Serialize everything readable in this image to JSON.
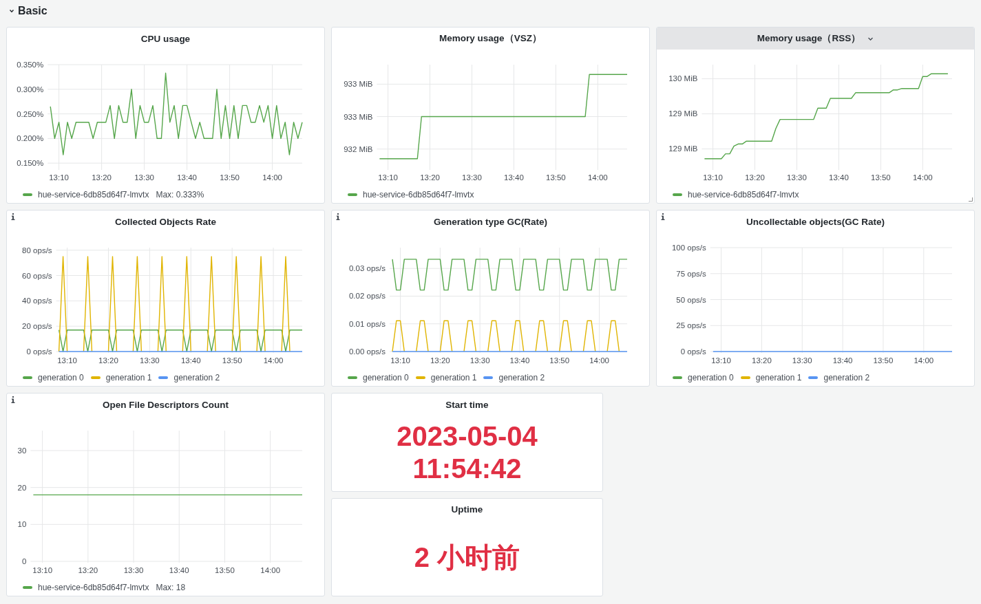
{
  "section": {
    "title": "Basic",
    "expanded": true
  },
  "panels": [
    {
      "kind": "graph",
      "title": "CPU usage",
      "hovered": false,
      "info": false,
      "legend_extra": "Max: 0.333%",
      "chart_data": {
        "type": "line",
        "grid": true,
        "ylim": [
          0.139,
          0.35
        ],
        "yticks": [
          {
            "value": 0.15,
            "label": "0.150%"
          },
          {
            "value": 0.2,
            "label": "0.200%"
          },
          {
            "value": 0.25,
            "label": "0.250%"
          },
          {
            "value": 0.3,
            "label": "0.300%"
          },
          {
            "value": 0.35,
            "label": "0.350%"
          }
        ],
        "categories": [
          null,
          null,
          "13:10",
          null,
          null,
          null,
          null,
          null,
          null,
          null,
          null,
          null,
          "13:20",
          null,
          null,
          null,
          null,
          null,
          null,
          null,
          null,
          null,
          "13:30",
          null,
          null,
          null,
          null,
          null,
          null,
          null,
          null,
          null,
          "13:40",
          null,
          null,
          null,
          null,
          null,
          null,
          null,
          null,
          null,
          "13:50",
          null,
          null,
          null,
          null,
          null,
          null,
          null,
          null,
          null,
          "14:00",
          null,
          null,
          null,
          null,
          null,
          null,
          null
        ],
        "series": [
          {
            "name": "hue-service-6db85d64f7-lmvtx",
            "color": "#56a64b",
            "values": [
              0.265,
              0.2,
              0.233,
              0.167,
              0.233,
              0.2,
              0.233,
              0.233,
              0.233,
              0.233,
              0.2,
              0.233,
              0.233,
              0.233,
              0.267,
              0.2,
              0.267,
              0.233,
              0.233,
              0.3,
              0.2,
              0.267,
              0.233,
              0.233,
              0.267,
              0.2,
              0.2,
              0.333,
              0.233,
              0.267,
              0.2,
              0.267,
              0.267,
              0.233,
              0.2,
              0.233,
              0.2,
              0.2,
              0.2,
              0.3,
              0.2,
              0.267,
              0.2,
              0.267,
              0.2,
              0.267,
              0.267,
              0.233,
              0.233,
              0.267,
              0.233,
              0.267,
              0.2,
              0.267,
              0.2,
              0.233,
              0.167,
              0.233,
              0.2,
              0.233
            ]
          }
        ]
      }
    },
    {
      "kind": "graph",
      "title": "Memory usage（VSZ）",
      "hovered": false,
      "info": false,
      "chart_data": {
        "type": "line",
        "grid": true,
        "ylim": [
          931.7,
          933.3
        ],
        "yticks": [
          {
            "value": 932,
            "label": "932 MiB"
          },
          {
            "value": 932.5,
            "label": "933 MiB"
          },
          {
            "value": 933,
            "label": "933 MiB"
          }
        ],
        "categories": [
          null,
          null,
          "13:10",
          null,
          null,
          null,
          null,
          null,
          null,
          null,
          null,
          null,
          "13:20",
          null,
          null,
          null,
          null,
          null,
          null,
          null,
          null,
          null,
          "13:30",
          null,
          null,
          null,
          null,
          null,
          null,
          null,
          null,
          null,
          "13:40",
          null,
          null,
          null,
          null,
          null,
          null,
          null,
          null,
          null,
          "13:50",
          null,
          null,
          null,
          null,
          null,
          null,
          null,
          null,
          null,
          "14:00",
          null,
          null,
          null,
          null,
          null,
          null,
          null
        ],
        "series": [
          {
            "name": "hue-service-6db85d64f7-lmvtx",
            "color": "#56a64b",
            "values": [
              931.85,
              931.85,
              931.85,
              931.85,
              931.85,
              931.85,
              931.85,
              931.85,
              931.85,
              931.85,
              932.5,
              932.5,
              932.5,
              932.5,
              932.5,
              932.5,
              932.5,
              932.5,
              932.5,
              932.5,
              932.5,
              932.5,
              932.5,
              932.5,
              932.5,
              932.5,
              932.5,
              932.5,
              932.5,
              932.5,
              932.5,
              932.5,
              932.5,
              932.5,
              932.5,
              932.5,
              932.5,
              932.5,
              932.5,
              932.5,
              932.5,
              932.5,
              932.5,
              932.5,
              932.5,
              932.5,
              932.5,
              932.5,
              932.5,
              932.5,
              933.15,
              933.15,
              933.15,
              933.15,
              933.15,
              933.15,
              933.15,
              933.15,
              933.15,
              933.15
            ]
          }
        ]
      }
    },
    {
      "kind": "graph",
      "title": "Memory usage（RSS）",
      "hovered": true,
      "info": false,
      "chart_data": {
        "type": "line",
        "grid": true,
        "ylim": [
          128.72,
          130.2
        ],
        "yticks": [
          {
            "value": 129,
            "label": "129 MiB"
          },
          {
            "value": 129.5,
            "label": "129 MiB"
          },
          {
            "value": 130,
            "label": "130 MiB"
          }
        ],
        "categories": [
          null,
          null,
          "13:10",
          null,
          null,
          null,
          null,
          null,
          null,
          null,
          null,
          null,
          "13:20",
          null,
          null,
          null,
          null,
          null,
          null,
          null,
          null,
          null,
          "13:30",
          null,
          null,
          null,
          null,
          null,
          null,
          null,
          null,
          null,
          "13:40",
          null,
          null,
          null,
          null,
          null,
          null,
          null,
          null,
          null,
          "13:50",
          null,
          null,
          null,
          null,
          null,
          null,
          null,
          null,
          null,
          "14:00",
          null,
          null,
          null,
          null,
          null,
          null,
          null
        ],
        "series": [
          {
            "name": "hue-service-6db85d64f7-lmvtx",
            "color": "#56a64b",
            "values": [
              128.86,
              128.86,
              128.86,
              128.86,
              128.86,
              128.93,
              128.93,
              129.04,
              129.07,
              129.07,
              129.11,
              129.11,
              129.11,
              129.11,
              129.11,
              129.11,
              129.11,
              129.29,
              129.42,
              129.42,
              129.42,
              129.42,
              129.42,
              129.42,
              129.42,
              129.42,
              129.42,
              129.58,
              129.58,
              129.58,
              129.72,
              129.72,
              129.72,
              129.72,
              129.72,
              129.72,
              129.8,
              129.8,
              129.8,
              129.8,
              129.8,
              129.8,
              129.8,
              129.8,
              129.8,
              129.84,
              129.84,
              129.86,
              129.86,
              129.86,
              129.86,
              129.86,
              130.03,
              130.03,
              130.07,
              130.07,
              130.07,
              130.07,
              130.07,
              null
            ]
          }
        ]
      }
    },
    {
      "kind": "graph",
      "title": "Collected Objects Rate",
      "hovered": false,
      "info": true,
      "chart_data": {
        "type": "line",
        "grid": true,
        "ylim": [
          0,
          82
        ],
        "yticks": [
          {
            "value": 0,
            "label": "0 ops/s"
          },
          {
            "value": 20,
            "label": "20 ops/s"
          },
          {
            "value": 40,
            "label": "40 ops/s"
          },
          {
            "value": 60,
            "label": "60 ops/s"
          },
          {
            "value": 80,
            "label": "80 ops/s"
          }
        ],
        "categories": [
          null,
          null,
          "13:10",
          null,
          null,
          null,
          null,
          null,
          null,
          null,
          null,
          null,
          "13:20",
          null,
          null,
          null,
          null,
          null,
          null,
          null,
          null,
          null,
          "13:30",
          null,
          null,
          null,
          null,
          null,
          null,
          null,
          null,
          null,
          "13:40",
          null,
          null,
          null,
          null,
          null,
          null,
          null,
          null,
          null,
          "13:50",
          null,
          null,
          null,
          null,
          null,
          null,
          null,
          null,
          null,
          "14:00",
          null,
          null,
          null,
          null,
          null,
          null,
          null
        ],
        "series": [
          {
            "name": "generation 0",
            "color": "#56a64b",
            "values": [
              17,
              0,
              17,
              17,
              17,
              17,
              17,
              0,
              17,
              17,
              17,
              17,
              17,
              0,
              17,
              17,
              17,
              17,
              17,
              0,
              17,
              17,
              17,
              17,
              17,
              0,
              17,
              17,
              17,
              17,
              17,
              0,
              17,
              17,
              17,
              17,
              17,
              0,
              17,
              17,
              17,
              17,
              17,
              0,
              17,
              17,
              17,
              17,
              17,
              0,
              17,
              17,
              17,
              17,
              17,
              0,
              17,
              17,
              17,
              17
            ]
          },
          {
            "name": "generation 1",
            "color": "#e0b400",
            "values": [
              0,
              75,
              0,
              null,
              null,
              null,
              0,
              75,
              0,
              null,
              null,
              null,
              0,
              75,
              0,
              null,
              null,
              null,
              0,
              75,
              0,
              null,
              null,
              null,
              0,
              75,
              0,
              null,
              null,
              null,
              0,
              75,
              0,
              null,
              null,
              null,
              0,
              75,
              0,
              null,
              null,
              null,
              0,
              75,
              0,
              null,
              null,
              null,
              0,
              75,
              0,
              null,
              null,
              null,
              0,
              75,
              0,
              null,
              null,
              null
            ]
          },
          {
            "name": "generation 2",
            "color": "#5794f2",
            "values": [
              0,
              0,
              0,
              0,
              0,
              0,
              0,
              0,
              0,
              0,
              0,
              0,
              0,
              0,
              0,
              0,
              0,
              0,
              0,
              0,
              0,
              0,
              0,
              0,
              0,
              0,
              0,
              0,
              0,
              0,
              0,
              0,
              0,
              0,
              0,
              0,
              0,
              0,
              0,
              0,
              0,
              0,
              0,
              0,
              0,
              0,
              0,
              0,
              0,
              0,
              0,
              0,
              0,
              0,
              0,
              0,
              0,
              0,
              0,
              0
            ]
          }
        ]
      }
    },
    {
      "kind": "graph",
      "title": "Generation type GC(Rate)",
      "hovered": false,
      "info": true,
      "chart_data": {
        "type": "line",
        "grid": true,
        "ylim": [
          0,
          0.0375
        ],
        "yticks": [
          {
            "value": 0,
            "label": "0.00 ops/s"
          },
          {
            "value": 0.01,
            "label": "0.01 ops/s"
          },
          {
            "value": 0.02,
            "label": "0.02 ops/s"
          },
          {
            "value": 0.03,
            "label": "0.03 ops/s"
          }
        ],
        "categories": [
          null,
          null,
          "13:10",
          null,
          null,
          null,
          null,
          null,
          null,
          null,
          null,
          null,
          "13:20",
          null,
          null,
          null,
          null,
          null,
          null,
          null,
          null,
          null,
          "13:30",
          null,
          null,
          null,
          null,
          null,
          null,
          null,
          null,
          null,
          "13:40",
          null,
          null,
          null,
          null,
          null,
          null,
          null,
          null,
          null,
          "13:50",
          null,
          null,
          null,
          null,
          null,
          null,
          null,
          null,
          null,
          "14:00",
          null,
          null,
          null,
          null,
          null,
          null,
          null
        ],
        "series": [
          {
            "name": "generation 0",
            "color": "#56a64b",
            "values": [
              0.0333,
              0.0222,
              0.0222,
              0.0333,
              0.0333,
              0.0333,
              0.0333,
              0.0222,
              0.0222,
              0.0333,
              0.0333,
              0.0333,
              0.0333,
              0.0222,
              0.0222,
              0.0333,
              0.0333,
              0.0333,
              0.0333,
              0.0222,
              0.0222,
              0.0333,
              0.0333,
              0.0333,
              0.0333,
              0.0222,
              0.0222,
              0.0333,
              0.0333,
              0.0333,
              0.0333,
              0.0222,
              0.0222,
              0.0333,
              0.0333,
              0.0333,
              0.0333,
              0.0222,
              0.0222,
              0.0333,
              0.0333,
              0.0333,
              0.0333,
              0.0222,
              0.0222,
              0.0333,
              0.0333,
              0.0333,
              0.0333,
              0.0222,
              0.0222,
              0.0333,
              0.0333,
              0.0333,
              0.0333,
              0.0222,
              0.0222,
              0.0333,
              0.0333,
              0.0333
            ]
          },
          {
            "name": "generation 1",
            "color": "#e0b400",
            "values": [
              0,
              0.0111,
              0.0111,
              0,
              null,
              null,
              0,
              0.0111,
              0.0111,
              0,
              null,
              null,
              0,
              0.0111,
              0.0111,
              0,
              null,
              null,
              0,
              0.0111,
              0.0111,
              0,
              null,
              null,
              0,
              0.0111,
              0.0111,
              0,
              null,
              null,
              0,
              0.0111,
              0.0111,
              0,
              null,
              null,
              0,
              0.0111,
              0.0111,
              0,
              null,
              null,
              0,
              0.0111,
              0.0111,
              0,
              null,
              null,
              0,
              0.0111,
              0.0111,
              0,
              null,
              null,
              0,
              0.0111,
              0.0111,
              0,
              null,
              null
            ]
          },
          {
            "name": "generation 2",
            "color": "#5794f2",
            "values": [
              0,
              0,
              0,
              0,
              0,
              0,
              0,
              0,
              0,
              0,
              0,
              0,
              0,
              0,
              0,
              0,
              0,
              0,
              0,
              0,
              0,
              0,
              0,
              0,
              0,
              0,
              0,
              0,
              0,
              0,
              0,
              0,
              0,
              0,
              0,
              0,
              0,
              0,
              0,
              0,
              0,
              0,
              0,
              0,
              0,
              0,
              0,
              0,
              0,
              0,
              0,
              0,
              0,
              0,
              0,
              0,
              0,
              0,
              0,
              0
            ]
          }
        ]
      }
    },
    {
      "kind": "graph",
      "title": "Uncollectable objects(GC Rate)",
      "hovered": false,
      "info": true,
      "chart_data": {
        "type": "line",
        "grid": true,
        "ylim": [
          0,
          100
        ],
        "yticks": [
          {
            "value": 0,
            "label": "0 ops/s"
          },
          {
            "value": 25,
            "label": "25 ops/s"
          },
          {
            "value": 50,
            "label": "50 ops/s"
          },
          {
            "value": 75,
            "label": "75 ops/s"
          },
          {
            "value": 100,
            "label": "100 ops/s"
          }
        ],
        "categories": [
          null,
          null,
          "13:10",
          null,
          null,
          null,
          null,
          null,
          null,
          null,
          null,
          null,
          "13:20",
          null,
          null,
          null,
          null,
          null,
          null,
          null,
          null,
          null,
          "13:30",
          null,
          null,
          null,
          null,
          null,
          null,
          null,
          null,
          null,
          "13:40",
          null,
          null,
          null,
          null,
          null,
          null,
          null,
          null,
          null,
          "13:50",
          null,
          null,
          null,
          null,
          null,
          null,
          null,
          null,
          null,
          "14:00",
          null,
          null,
          null,
          null,
          null,
          null,
          null
        ],
        "series": [
          {
            "name": "generation 0",
            "color": "#56a64b",
            "values": [
              null,
              null,
              null,
              null,
              null,
              null,
              null,
              null,
              null,
              null,
              null,
              null,
              null,
              null,
              null,
              null,
              null,
              null,
              null,
              null,
              null,
              null,
              null,
              null,
              null,
              null,
              null,
              null,
              null,
              null,
              null,
              null,
              null,
              null,
              null,
              null,
              null,
              null,
              null,
              null,
              null,
              null,
              null,
              null,
              null,
              null,
              null,
              null,
              null,
              null,
              null,
              null,
              null,
              null,
              null,
              null,
              null,
              null,
              null,
              null
            ]
          },
          {
            "name": "generation 1",
            "color": "#e0b400",
            "values": [
              null,
              null,
              null,
              null,
              null,
              null,
              null,
              null,
              null,
              null,
              null,
              null,
              null,
              null,
              null,
              null,
              null,
              null,
              null,
              null,
              null,
              null,
              null,
              null,
              null,
              null,
              null,
              null,
              null,
              null,
              null,
              null,
              null,
              null,
              null,
              null,
              null,
              null,
              null,
              null,
              null,
              null,
              null,
              null,
              null,
              null,
              null,
              null,
              null,
              null,
              null,
              null,
              null,
              null,
              null,
              null,
              null,
              null,
              null,
              null
            ]
          },
          {
            "name": "generation 2",
            "color": "#5794f2",
            "values": [
              0,
              0,
              0,
              0,
              0,
              0,
              0,
              0,
              0,
              0,
              0,
              0,
              0,
              0,
              0,
              0,
              0,
              0,
              0,
              0,
              0,
              0,
              0,
              0,
              0,
              0,
              0,
              0,
              0,
              0,
              0,
              0,
              0,
              0,
              0,
              0,
              0,
              0,
              0,
              0,
              0,
              0,
              0,
              0,
              0,
              0,
              0,
              0,
              0,
              0,
              0,
              0,
              0,
              0,
              0,
              0,
              0,
              0,
              0,
              0
            ]
          }
        ]
      }
    },
    {
      "kind": "graph",
      "title": "Open File Descriptors Count",
      "hovered": false,
      "info": true,
      "legend_extra": "Max: 18",
      "chart_data": {
        "type": "line",
        "grid": true,
        "ylim": [
          0,
          35.4
        ],
        "yticks": [
          {
            "value": 0,
            "label": "0"
          },
          {
            "value": 10,
            "label": "10"
          },
          {
            "value": 20,
            "label": "20"
          },
          {
            "value": 30,
            "label": "30"
          }
        ],
        "categories": [
          null,
          null,
          "13:10",
          null,
          null,
          null,
          null,
          null,
          null,
          null,
          null,
          null,
          "13:20",
          null,
          null,
          null,
          null,
          null,
          null,
          null,
          null,
          null,
          "13:30",
          null,
          null,
          null,
          null,
          null,
          null,
          null,
          null,
          null,
          "13:40",
          null,
          null,
          null,
          null,
          null,
          null,
          null,
          null,
          null,
          "13:50",
          null,
          null,
          null,
          null,
          null,
          null,
          null,
          null,
          null,
          "14:00",
          null,
          null,
          null,
          null,
          null,
          null,
          null
        ],
        "series": [
          {
            "name": "hue-service-6db85d64f7-lmvtx",
            "color": "#56a64b",
            "values": [
              18,
              18,
              18,
              18,
              18,
              18,
              18,
              18,
              18,
              18,
              18,
              18,
              18,
              18,
              18,
              18,
              18,
              18,
              18,
              18,
              18,
              18,
              18,
              18,
              18,
              18,
              18,
              18,
              18,
              18,
              18,
              18,
              18,
              18,
              18,
              18,
              18,
              18,
              18,
              18,
              18,
              18,
              18,
              18,
              18,
              18,
              18,
              18,
              18,
              18,
              18,
              18,
              18,
              18,
              18,
              18,
              18,
              18,
              18,
              18
            ]
          }
        ]
      }
    },
    {
      "kind": "stat",
      "title": "Start time",
      "color": "#e02f44",
      "value_lines": [
        "2023-05-04",
        "11:54:42"
      ]
    },
    {
      "kind": "stat",
      "title": "Uptime",
      "color": "#e02f44",
      "value_lines": [
        "2 小时前"
      ]
    }
  ]
}
